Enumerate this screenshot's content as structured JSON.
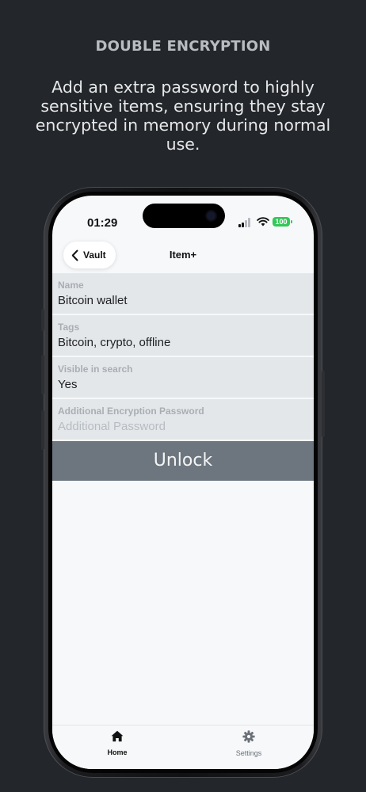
{
  "promo": {
    "headline": "DOUBLE ENCRYPTION",
    "subtext": "Add an extra password to highly sensitive items, ensuring they stay encrypted in memory during normal use."
  },
  "status_bar": {
    "time": "01:29",
    "battery": "100"
  },
  "nav": {
    "back_label": "Vault",
    "title": "Item+"
  },
  "fields": [
    {
      "label": "Name",
      "value": "Bitcoin wallet"
    },
    {
      "label": "Tags",
      "value": "Bitcoin, crypto, offline"
    },
    {
      "label": "Visible in search",
      "value": "Yes"
    },
    {
      "label": "Additional Encryption Password",
      "placeholder": "Additional Password",
      "value": ""
    }
  ],
  "unlock_label": "Unlock",
  "tabs": [
    {
      "label": "Home",
      "icon": "home-icon",
      "active": true
    },
    {
      "label": "Settings",
      "icon": "gear-icon",
      "active": false
    }
  ],
  "colors": {
    "background": "#23262a",
    "unlock_button": "#6d767e",
    "field_background": "#e4e7ea",
    "battery": "#34c759"
  }
}
